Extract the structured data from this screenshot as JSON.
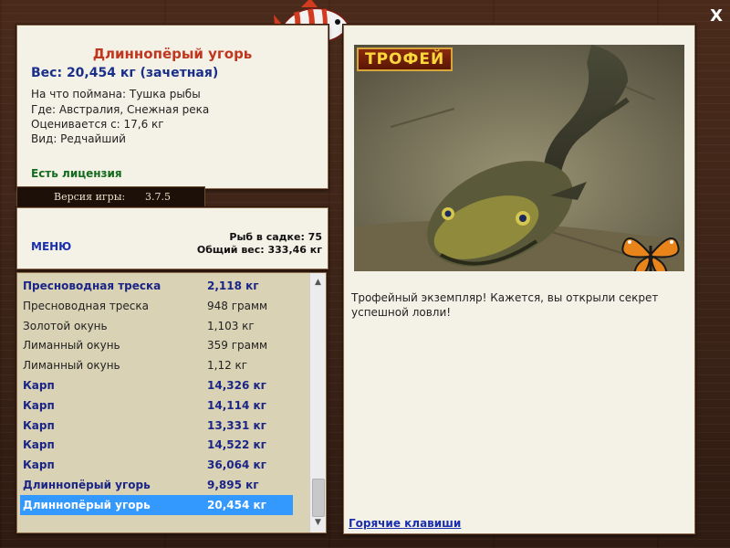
{
  "catch": {
    "title": "Длиннопёрый угорь",
    "weight": "Вес: 20,454 кг (зачетная)",
    "caught_on": "На что поймана: Тушка рыбы",
    "location": "Где: Австралия, Снежная река",
    "valued_from": "Оценивается с: 17,6 кг",
    "kind": "Вид: Редчайший",
    "license": "Есть лицензия"
  },
  "version": {
    "label": "Версия игры:",
    "value": "3.7.5"
  },
  "stats": {
    "menu": "МЕНЮ",
    "fish_in_keepnet": "Рыб в садке: 75",
    "total_weight": "Общий вес: 333,46 кг"
  },
  "fish_list": [
    {
      "name": "Пресноводная треска",
      "weight": "2,118 кг",
      "style": "bold"
    },
    {
      "name": "Пресноводная треска",
      "weight": "948 грамм",
      "style": "normal"
    },
    {
      "name": "Золотой окунь",
      "weight": "1,103 кг",
      "style": "normal"
    },
    {
      "name": "Лиманный окунь",
      "weight": "359 грамм",
      "style": "normal"
    },
    {
      "name": "Лиманный окунь",
      "weight": "1,12 кг",
      "style": "normal"
    },
    {
      "name": "Карп",
      "weight": "14,326 кг",
      "style": "bold"
    },
    {
      "name": "Карп",
      "weight": "14,114 кг",
      "style": "bold"
    },
    {
      "name": "Карп",
      "weight": "13,331 кг",
      "style": "bold"
    },
    {
      "name": "Карп",
      "weight": "14,522 кг",
      "style": "bold"
    },
    {
      "name": "Карп",
      "weight": "36,064 кг",
      "style": "bold"
    },
    {
      "name": "Длиннопёрый угорь",
      "weight": "9,895 кг",
      "style": "bold"
    },
    {
      "name": "Длиннопёрый угорь",
      "weight": "20,454 кг",
      "style": "selected"
    }
  ],
  "detail": {
    "badge": "ТРОФЕЙ",
    "text": "Трофейный экземпляр! Кажется, вы открыли секрет успешной ловли!",
    "hotkeys": "Горячие клавиши"
  },
  "window": {
    "close": "X"
  },
  "icons": {
    "logo": "striped-fish-icon",
    "close": "close-icon",
    "butterfly": "butterfly-icon",
    "scroll_up": "scroll-up-arrow-icon",
    "scroll_down": "scroll-down-arrow-icon"
  },
  "colors": {
    "title": "#c0361e",
    "weight": "#1a2f8a",
    "license": "#146a1e",
    "link": "#1a2fb0",
    "selection": "#3399ff",
    "badge_text": "#ffd83b"
  }
}
